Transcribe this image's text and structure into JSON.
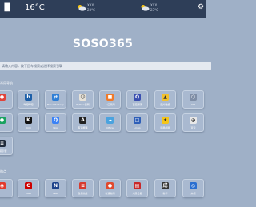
{
  "topbar": {
    "temperature": "16°C",
    "weather": [
      {
        "icon": "partly-cloudy-icon",
        "line1": "XXX",
        "line2": "23°C"
      },
      {
        "icon": "partly-cloudy-icon",
        "line1": "XXX",
        "line2": "23°C"
      }
    ]
  },
  "site_title": "SOSO365",
  "search": {
    "placeholder": "请输入内容，按下回车搜索或选择搜索引擎"
  },
  "sections": [
    {
      "title": "常用导航",
      "items": [
        {
          "label": "",
          "color": "#e0433a",
          "icon": "red-circle-icon",
          "glyph": "●"
        },
        {
          "label": "哔哩哔哩",
          "color": "#1d5fa8",
          "icon": "bilibili-icon",
          "glyph": "b"
        },
        {
          "label": "BeautifulSoup",
          "color": "#2f7fd6",
          "icon": "swap-icon",
          "glyph": "⇄"
        },
        {
          "label": "Python官网",
          "color": "#e7e2d8",
          "icon": "python-face-icon",
          "glyph": "☺"
        },
        {
          "label": "AI工具网",
          "color": "#f07a2a",
          "icon": "orange-square-icon",
          "glyph": "■"
        },
        {
          "label": "百度翻译",
          "color": "#3a4fb0",
          "icon": "magnifier-icon",
          "glyph": "Q"
        },
        {
          "label": "图片壁纸",
          "color": "#f2c12e",
          "icon": "landscape-icon",
          "glyph": "▲"
        },
        {
          "label": "VM",
          "color": "#7f8ea6",
          "icon": "hexagon-icon",
          "glyph": "⬡"
        },
        {
          "label": "",
          "color": "#1aa260",
          "icon": "green-circle-icon",
          "glyph": "●"
        },
        {
          "label": "Kimi",
          "color": "#111111",
          "icon": "k-logo-icon",
          "glyph": "K"
        },
        {
          "label": "Wps",
          "color": "#3b82f6",
          "icon": "q-logo-icon",
          "glyph": "Q"
        },
        {
          "label": "有道翻译",
          "color": "#222222",
          "icon": "a-logo-icon",
          "glyph": "A"
        },
        {
          "label": "Office",
          "color": "#4aa3df",
          "icon": "cloud-icon",
          "glyph": "☁"
        },
        {
          "label": "Lingo",
          "color": "#2e5fb8",
          "icon": "square-icon",
          "glyph": "□"
        },
        {
          "label": "网易邮箱",
          "color": "#f5c518",
          "icon": "bee-icon",
          "glyph": "✦"
        },
        {
          "label": "豆包",
          "color": "#e8e8e8",
          "icon": "bird-icon",
          "glyph": "◕"
        },
        {
          "label": "搜索引擎",
          "color": "#1f2a3a",
          "icon": "bars-icon",
          "glyph": "≡"
        }
      ]
    },
    {
      "title": "热点",
      "items": [
        {
          "label": "",
          "color": "#e23b2e",
          "icon": "red-logo-icon",
          "glyph": "◉"
        },
        {
          "label": "CNN",
          "color": "#cc0000",
          "icon": "cnn-logo-icon",
          "glyph": "C"
        },
        {
          "label": "NBA",
          "color": "#1d428a",
          "icon": "nba-logo-icon",
          "glyph": "N"
        },
        {
          "label": "微博热搜",
          "color": "#d63b2f",
          "icon": "lines-icon",
          "glyph": "≡"
        },
        {
          "label": "新浪新闻",
          "color": "#e04a2f",
          "icon": "ball-icon",
          "glyph": "●"
        },
        {
          "label": "人民日报",
          "color": "#c8282a",
          "icon": "newspaper-icon",
          "glyph": "▤"
        },
        {
          "label": "新华",
          "color": "#333333",
          "icon": "character-icon",
          "glyph": "成"
        },
        {
          "label": "央视",
          "color": "#2b6fd0",
          "icon": "globe-icon",
          "glyph": "◎"
        }
      ]
    }
  ]
}
